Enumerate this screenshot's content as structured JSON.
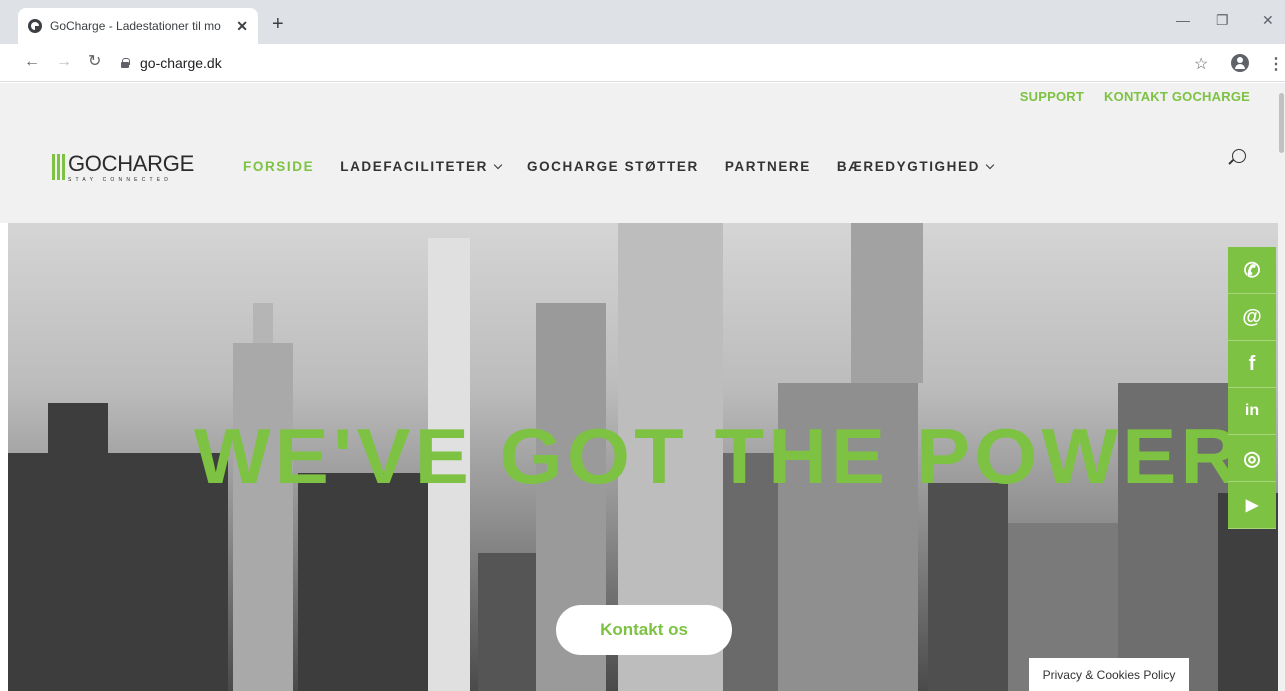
{
  "browser": {
    "tab_title": "GoCharge - Ladestationer til mo",
    "url": "go-charge.dk"
  },
  "site": {
    "top_links": [
      "SUPPORT",
      "KONTAKT GOCHARGE"
    ],
    "logo_text": "GOCHARGE",
    "logo_tagline": "STAY CONNECTED",
    "nav": [
      {
        "label": "FORSIDE",
        "active": true
      },
      {
        "label": "LADEFACILITETER",
        "dropdown": true
      },
      {
        "label": "GOCHARGE STØTTER"
      },
      {
        "label": "PARTNERE"
      },
      {
        "label": "BÆREDYGTIGHED",
        "dropdown": true
      }
    ]
  },
  "hero": {
    "headline": "WE'VE GOT THE POWER",
    "cta_label": "Kontakt os"
  },
  "social": [
    "phone-icon",
    "email-icon",
    "facebook-icon",
    "linkedin-icon",
    "instagram-icon",
    "youtube-icon"
  ],
  "privacy_label": "Privacy & Cookies Policy",
  "colors": {
    "accent": "#7dc242"
  }
}
